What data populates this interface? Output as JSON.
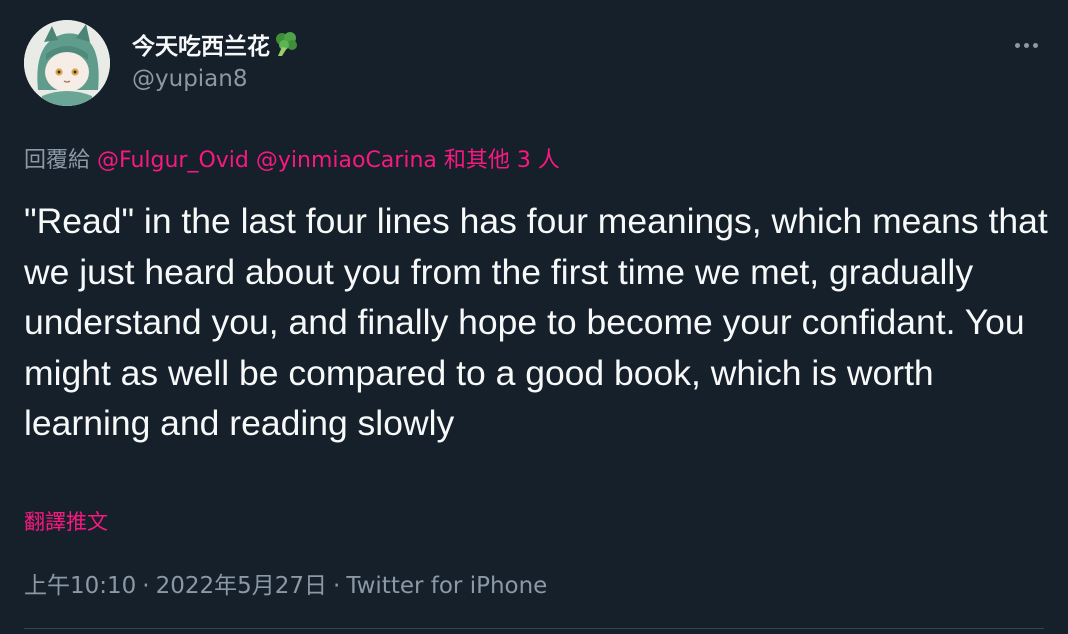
{
  "author": {
    "display_name": "今天吃西兰花",
    "handle": "@yupian8",
    "name_emoji": "broccoli-icon"
  },
  "reply": {
    "prefix": "回覆給",
    "mentions": [
      "@Fulgur_Ovid",
      "@yinmiaoCarina"
    ],
    "others": "和其他 3 人"
  },
  "tweet": {
    "text": "\"Read\" in the last four lines has four meanings, which means that we just heard about you from the first time we met, gradually understand you, and finally hope to become your confidant. You might as well be compared to a good book, which is worth learning and reading slowly",
    "translate_label": "翻譯推文"
  },
  "meta": {
    "time": "上午10:10",
    "date": "2022年5月27日",
    "source": "Twitter for iPhone",
    "separator": "·"
  },
  "colors": {
    "background": "#15202b",
    "text": "#f7f9f9",
    "secondary": "#8b98a5",
    "accent": "#f91880"
  }
}
